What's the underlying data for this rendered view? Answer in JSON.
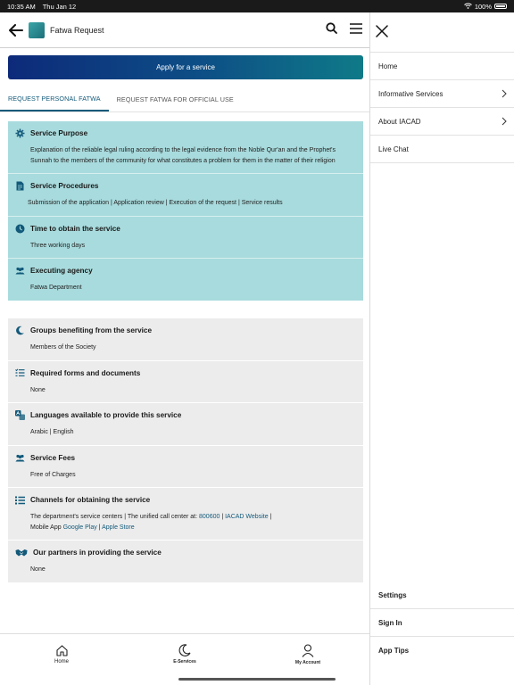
{
  "status_bar": {
    "time": "10:35 AM",
    "date": "Thu Jan 12",
    "battery": "100%"
  },
  "header": {
    "title": "Fatwa Request"
  },
  "apply_button": "Apply for a service",
  "tabs": [
    {
      "label": "REQUEST PERSONAL FATWA"
    },
    {
      "label": "REQUEST FATWA FOR OFFICIAL USE"
    }
  ],
  "teal_items": [
    {
      "title": "Service Purpose",
      "body": "Explanation of the reliable legal ruling according to the legal evidence from the Noble Qur'an and the Prophet's Sunnah to the members of the community for what constitutes a problem for them in the matter of their religion",
      "icon": "gear-icon"
    },
    {
      "title": "Service Procedures",
      "body": "Submission of the application | Application review | Execution of the request | Service results",
      "icon": "document-icon"
    },
    {
      "title": "Time to obtain the service",
      "body": "Three working days",
      "icon": "clock-icon"
    },
    {
      "title": "Executing agency",
      "body": "Fatwa Department",
      "icon": "people-icon"
    }
  ],
  "grey_items": [
    {
      "title": "Groups benefiting from the service",
      "body": "Members of the Society",
      "icon": "moon-icon"
    },
    {
      "title": "Required forms and documents",
      "body": "None",
      "icon": "checklist-icon"
    },
    {
      "title": "Languages available to provide this service",
      "body": "Arabic | English",
      "icon": "translate-icon"
    },
    {
      "title": "Service Fees",
      "body": "Free of Charges",
      "icon": "people-icon"
    },
    {
      "title": "Channels for obtaining the service",
      "icon": "list-icon",
      "body_parts": {
        "p1": "The department's service centers | The unified call center at: ",
        "phone": "800600",
        "sep1": " | ",
        "website": "IACAD Website",
        "sep2": " |",
        "p2": "Mobile App ",
        "google": "Google Play",
        "sep3": " | ",
        "apple": "Apple Store"
      }
    },
    {
      "title": "Our partners in providing the service",
      "body": "None",
      "icon": "handshake-icon"
    }
  ],
  "bottom_nav": [
    {
      "label": "Home",
      "icon": "home-icon"
    },
    {
      "label": "E-Services",
      "icon": "moon-icon"
    },
    {
      "label": "My Account",
      "icon": "user-icon"
    }
  ],
  "drawer": {
    "menu": [
      {
        "label": "Home",
        "chevron": false
      },
      {
        "label": "Informative Services",
        "chevron": true
      },
      {
        "label": "About IACAD",
        "chevron": true
      },
      {
        "label": "Live Chat",
        "chevron": false
      }
    ],
    "bottom": [
      {
        "label": "Settings"
      },
      {
        "label": "Sign In"
      },
      {
        "label": "App Tips"
      }
    ]
  },
  "colors": {
    "accent": "#12597a",
    "teal_panel": "#a8dbdd",
    "grey_panel": "#ececec"
  }
}
